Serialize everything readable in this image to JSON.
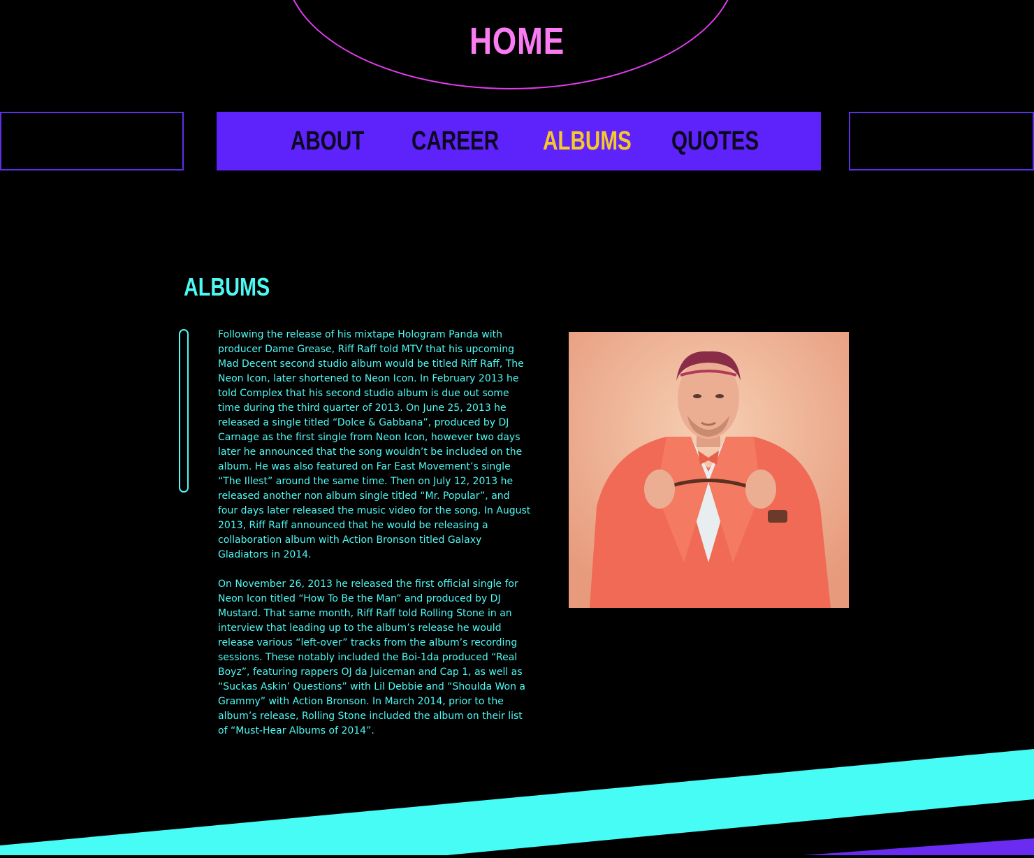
{
  "header": {
    "home_label": "HOME"
  },
  "nav": {
    "items": [
      {
        "label": "ABOUT",
        "active": false
      },
      {
        "label": "CAREER",
        "active": false
      },
      {
        "label": "ALBUMS",
        "active": true
      },
      {
        "label": "QUOTES",
        "active": false
      }
    ]
  },
  "section": {
    "title": "ALBUMS",
    "paragraphs": [
      "Following the release of his mixtape Hologram Panda with producer Dame Grease, Riff Raff told MTV that his upcoming Mad Decent second studio album would be titled Riff Raff, The Neon Icon, later shortened to Neon Icon. In February 2013 he told Complex that his second studio album is due out some time during the third quarter of 2013. On June 25, 2013 he released a single titled “Dolce & Gabbana”, produced by DJ Carnage as the first single from Neon Icon, however two days later he announced that the song wouldn’t be included on the album. He was also featured on Far East Movement’s single “The Illest” around the same time. Then on July 12, 2013 he released another non album single titled “Mr. Popular”, and four days later released the music video for the song. In August 2013, Riff Raff announced that he would be releasing a collaboration album with Action Bronson titled Galaxy Gladiators in 2014.",
      "On November 26, 2013 he released the first official single for Neon Icon titled “How To Be the Man” and produced by DJ Mustard. That same month, Riff Raff told Rolling Stone in an interview that leading up to the album’s release he would release various “left-over” tracks from the album’s recording sessions. These notably included the Boi-1da produced “Real Boyz”, featuring rappers OJ da Juiceman and Cap 1, as well as “Suckas Askin’ Questions” with Lil Debbie and “Shoulda Won a Grammy” with Action Bronson. In March 2014, prior to the album’s release, Rolling Stone included the album on their list of “Must-Hear Albums of 2014”."
    ]
  },
  "colors": {
    "background": "#000000",
    "home": "#fb7cf2",
    "ellipse": "#e43df0",
    "nav_bar": "#5e22fb",
    "nav_text": "#0b0820",
    "nav_active": "#f5c929",
    "accent_cyan": "#4dfaf3",
    "footer_purple": "#6a2cf0"
  }
}
